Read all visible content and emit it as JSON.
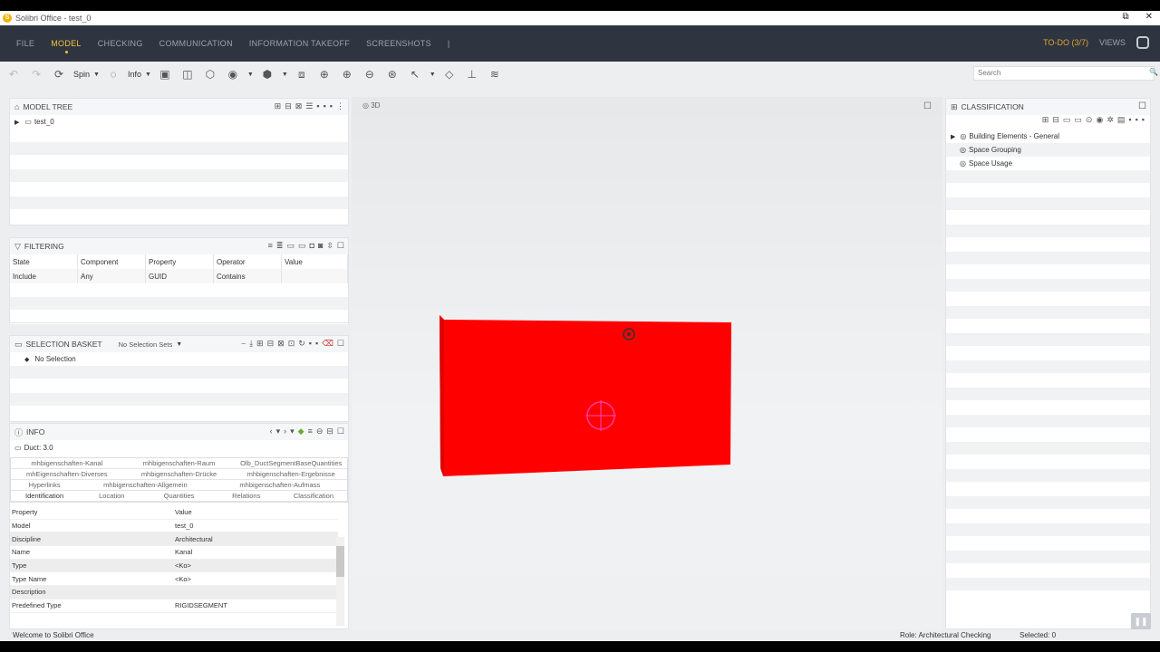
{
  "window": {
    "title": "Solibri Office - test_0",
    "controls": [
      "⧉",
      "✕"
    ]
  },
  "menu": {
    "items": [
      "FILE",
      "MODEL",
      "CHECKING",
      "COMMUNICATION",
      "INFORMATION TAKEOFF",
      "SCREENSHOTS"
    ],
    "active": "MODEL",
    "todo": "TO-DO (3/7)",
    "views": "VIEWS"
  },
  "toolbar": {
    "spin_label": "Spin",
    "info_label": "Info",
    "search_placeholder": "Search"
  },
  "model_tree": {
    "title": "MODEL TREE",
    "root": "test_0"
  },
  "filtering": {
    "title": "FILTERING",
    "columns": [
      "State",
      "Component",
      "Property",
      "Operator",
      "Value"
    ],
    "rows": [
      [
        "Include",
        "Any",
        "GUID",
        "Contains",
        ""
      ]
    ]
  },
  "selection_basket": {
    "title": "SELECTION BASKET",
    "sets_label": "No Selection Sets",
    "item": "No Selection"
  },
  "info": {
    "title": "INFO",
    "subtitle": "Duct: 3.0",
    "tabs_row1": [
      "mhbigenschaften-Kanal",
      "mhbigenschaften-Raum",
      "Olb_DuctSegmentBaseQuantities"
    ],
    "tabs_row2": [
      "mhEigenschaften-Diverses",
      "mhbigenschaften-Drücke",
      "mhbigenschaften-Ergebnisse"
    ],
    "tabs_row3": [
      "Hyperlinks",
      "mhbigenschaften-Allgemein",
      "mhbigenschaften-Aufmass"
    ],
    "tabs_row4": [
      "Identification",
      "Location",
      "Quantities",
      "Relations",
      "Classification"
    ],
    "table_header": [
      "Property",
      "Value"
    ],
    "rows": [
      [
        "Model",
        "test_0"
      ],
      [
        "Discipline",
        "Architectural"
      ],
      [
        "Name",
        "Kanal"
      ],
      [
        "Type",
        "<Ko>"
      ],
      [
        "Type Name",
        "<Ko>"
      ],
      [
        "Description",
        ""
      ],
      [
        "Predefined Type",
        "RIGIDSEGMENT"
      ]
    ]
  },
  "viewport": {
    "label": "3D"
  },
  "classification": {
    "title": "CLASSIFICATION",
    "items": [
      "Building Elements - General",
      "Space Grouping",
      "Space Usage"
    ]
  },
  "status": {
    "welcome": "Welcome to Solibri Office",
    "role": "Role: Architectural Checking",
    "selected": "Selected: 0"
  },
  "colors": {
    "object": "#ff0000",
    "accent": "#f3c33b",
    "menubar": "#2f3540"
  }
}
